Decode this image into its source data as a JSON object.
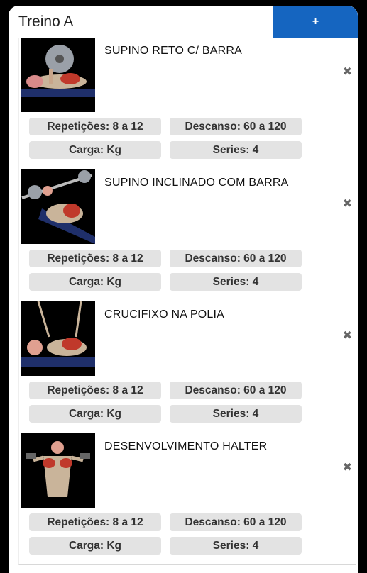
{
  "header": {
    "title": "Treino A",
    "add_label": "+"
  },
  "exercises": [
    {
      "name": "SUPINO RETO C/ BARRA",
      "reps": "Repetições: 8 a 12",
      "rest": "Descanso: 60 a 120",
      "load": "Carga: Kg",
      "series": "Series: 4",
      "remove": "✖"
    },
    {
      "name": "SUPINO INCLINADO COM BARRA",
      "reps": "Repetições: 8 a 12",
      "rest": "Descanso: 60 a 120",
      "load": "Carga: Kg",
      "series": "Series: 4",
      "remove": "✖"
    },
    {
      "name": "CRUCIFIXO NA POLIA",
      "reps": "Repetições: 8 a 12",
      "rest": "Descanso: 60 a 120",
      "load": "Carga: Kg",
      "series": "Series: 4",
      "remove": "✖"
    },
    {
      "name": "DESENVOLVIMENTO HALTER",
      "reps": "Repetições: 8 a 12",
      "rest": "Descanso: 60 a 120",
      "load": "Carga: Kg",
      "series": "Series: 4",
      "remove": "✖"
    }
  ],
  "colors": {
    "accent": "#1565c0",
    "pill": "#e3e3e3"
  }
}
